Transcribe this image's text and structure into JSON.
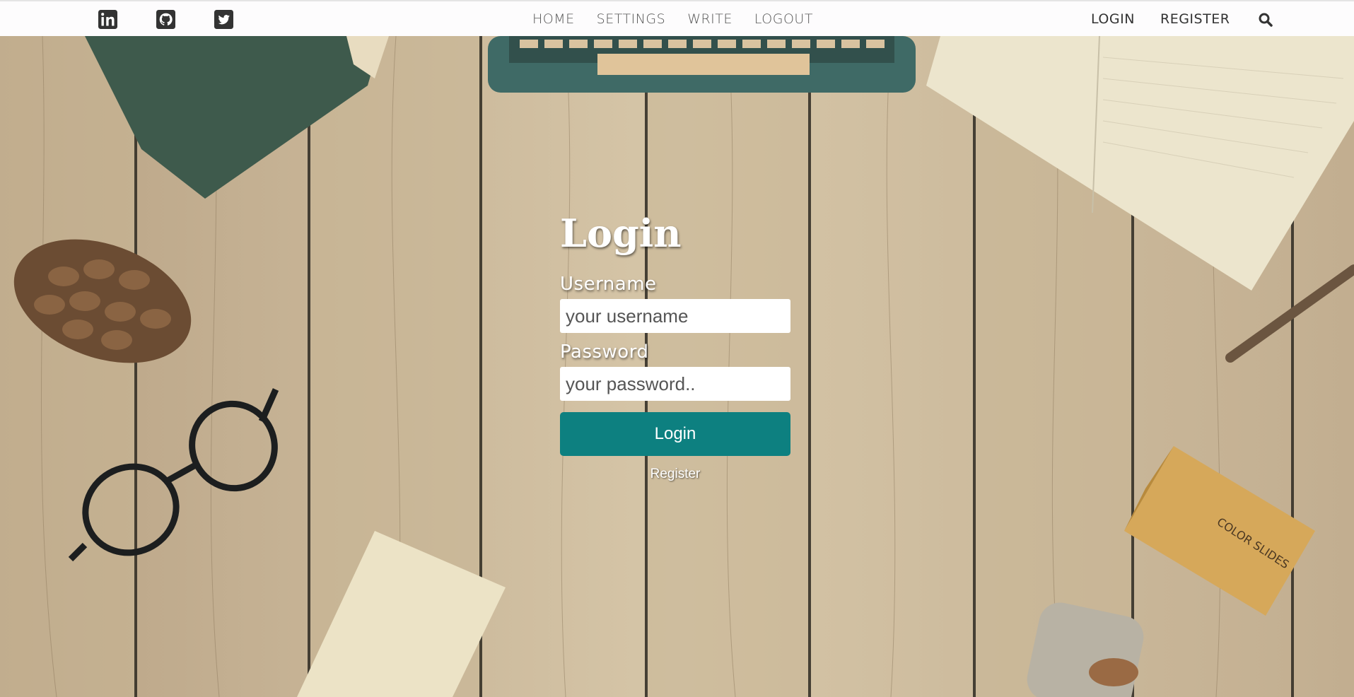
{
  "nav": {
    "social": [
      {
        "icon": "linkedin-icon"
      },
      {
        "icon": "github-icon"
      },
      {
        "icon": "twitter-icon"
      }
    ],
    "center_links": [
      "HOME",
      "SETTINGS",
      "WRITE",
      "LOGOUT"
    ],
    "right_links": {
      "login": "LOGIN",
      "register": "REGISTER"
    },
    "search_icon": "search-icon"
  },
  "login_form": {
    "title": "Login",
    "username_label": "Username",
    "username_placeholder": "your username",
    "password_label": "Password",
    "password_placeholder": "your password..",
    "submit_label": "Login",
    "register_link": "Register"
  },
  "colors": {
    "button": "#0d8080",
    "nav_bg": "#fdfcfd"
  },
  "background": {
    "objects": [
      "book",
      "typewriter",
      "notebook",
      "pine-cone",
      "glasses",
      "paper",
      "color-slides-box",
      "jar",
      "twig"
    ],
    "box_label": "COLOR SLIDES"
  }
}
